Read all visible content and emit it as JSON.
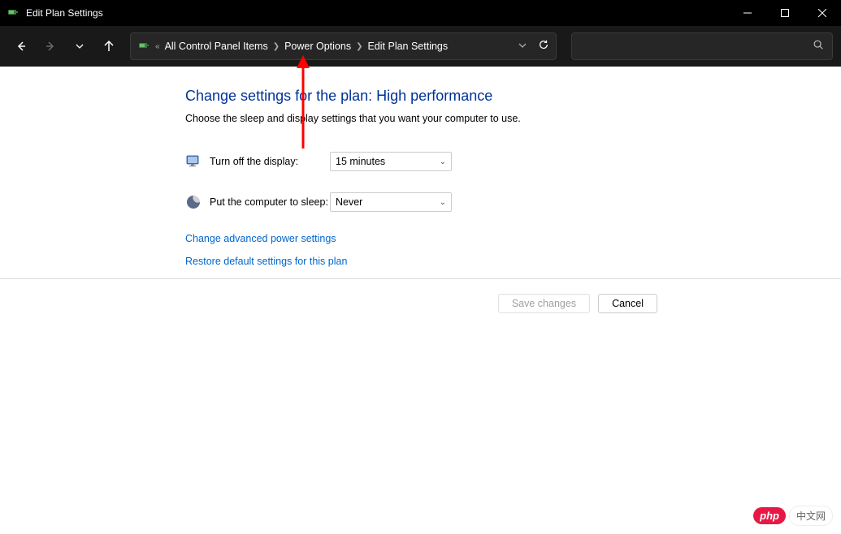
{
  "window": {
    "title": "Edit Plan Settings"
  },
  "breadcrumb": {
    "items": [
      "All Control Panel Items",
      "Power Options",
      "Edit Plan Settings"
    ]
  },
  "page": {
    "heading": "Change settings for the plan: High performance",
    "description": "Choose the sleep and display settings that you want your computer to use."
  },
  "settings": {
    "display_off": {
      "label": "Turn off the display:",
      "value": "15 minutes"
    },
    "sleep": {
      "label": "Put the computer to sleep:",
      "value": "Never"
    }
  },
  "links": {
    "advanced": "Change advanced power settings",
    "restore": "Restore default settings for this plan"
  },
  "buttons": {
    "save": "Save changes",
    "cancel": "Cancel"
  },
  "watermark": {
    "badge": "php",
    "text": "中文网"
  }
}
